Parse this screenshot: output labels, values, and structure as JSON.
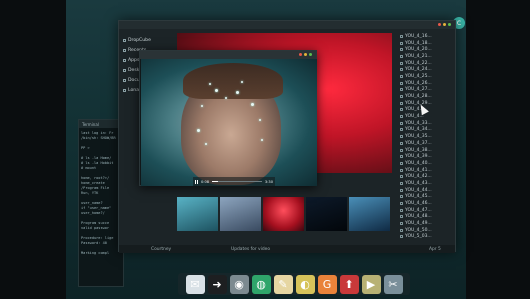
{
  "file_manager": {
    "sidebar": [
      {
        "label": "DropCube",
        "icon": "cloud-icon"
      },
      {
        "label": "Recents",
        "icon": "clock-icon"
      },
      {
        "label": "Apps",
        "icon": "apps-icon"
      },
      {
        "label": "Desk",
        "icon": "desktop-icon"
      },
      {
        "label": "Docu",
        "icon": "document-icon"
      },
      {
        "label": "Lona",
        "icon": "folder-icon"
      }
    ],
    "files": [
      "YOU_4_16...",
      "YOU_4_18...",
      "YOU_4_20...",
      "YOU_4_21...",
      "YOU_4_22...",
      "YOU_4_24...",
      "YOU_4_25...",
      "YOU_4_26...",
      "YOU_4_27...",
      "YOU_4_28...",
      "YOU_4_29...",
      "YOU_4...",
      "YOU_4...",
      "YOU_4_33...",
      "YOU_4_34...",
      "YOU_4_35...",
      "YOU_4_37...",
      "YOU_4_38...",
      "YOU_4_39...",
      "YOU_4_40...",
      "YOU_4_41...",
      "YOU_4_42...",
      "YOU_4_43...",
      "YOU_4_44...",
      "YOU_4_45...",
      "YOU_4_46...",
      "YOU_4_47...",
      "YOU_4_48...",
      "YOU_4_49...",
      "YOU_4_50...",
      "YOU_5_03..."
    ],
    "status_left": "Courtney",
    "status_mid": "Updates for video",
    "status_right": "Apr 5"
  },
  "terminal": {
    "title": "Terminal",
    "lines": [
      "last log in: Fr",
      "/bin/sh: SHOW/BR",
      "",
      "PP >",
      "",
      "# ls -la Home/",
      "# ls -la Hobbit",
      "# mount",
      "",
      "home, root?>/",
      "home_create",
      "/Program File",
      "Run, YTK",
      "",
      "user_name?",
      "if \"user_name\"",
      "user_home?/",
      "",
      "Program succe",
      "valid passwor",
      "",
      "Procedure: lige",
      "Password: 40",
      "",
      "Marking compl"
    ]
  },
  "player": {
    "time_current": "0:08",
    "time_total": "3:30",
    "progress": 0.12
  },
  "dock": [
    {
      "icon": "mail-icon",
      "glyph": "✉",
      "color": "#d9e1e6"
    },
    {
      "icon": "terminal-icon",
      "glyph": "➜",
      "color": "#1d1f21"
    },
    {
      "icon": "camera-icon",
      "glyph": "◉",
      "color": "#7c8a90"
    },
    {
      "icon": "globe-icon",
      "glyph": "◍",
      "color": "#2fa56a"
    },
    {
      "icon": "notes-icon",
      "glyph": "✎",
      "color": "#e6d6a2"
    },
    {
      "icon": "audio-icon",
      "glyph": "◐",
      "color": "#d6c35a"
    },
    {
      "icon": "g-app-icon",
      "glyph": "G",
      "color": "#e9833a"
    },
    {
      "icon": "map-pin-icon",
      "glyph": "⬆",
      "color": "#c9393a"
    },
    {
      "icon": "film-icon",
      "glyph": "▶",
      "color": "#b8b174"
    },
    {
      "icon": "tools-icon",
      "glyph": "✂",
      "color": "#7a8f9a"
    }
  ],
  "colors": {
    "accent": "#39b4a7",
    "red_bg": "#c01527",
    "dot_red": "#e8584a",
    "dot_yellow": "#e3b33b",
    "dot_green": "#5bbf4e"
  }
}
